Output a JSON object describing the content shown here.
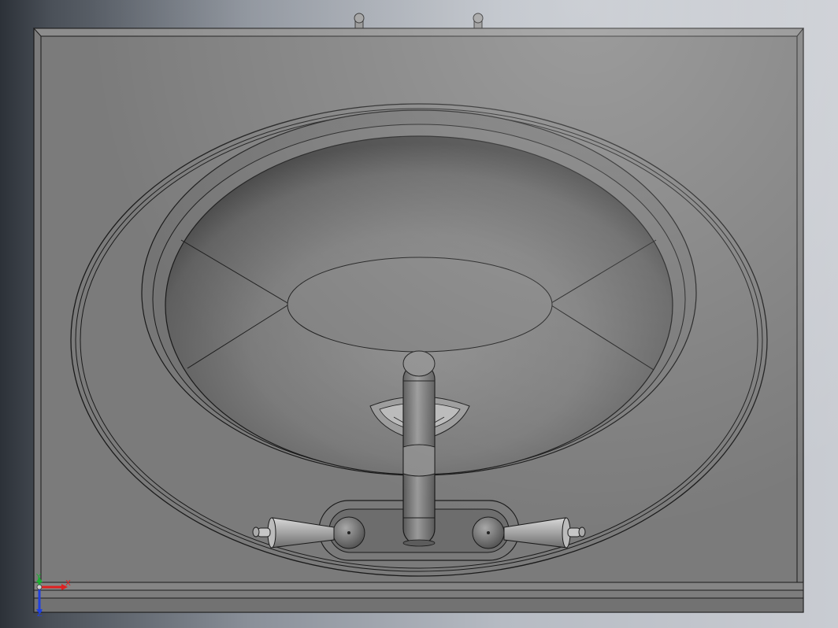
{
  "viewport": {
    "triad": {
      "x_label": "X",
      "y_label": "Y",
      "z_label": "Z",
      "x_color": "#e02020",
      "y_color": "#19b030",
      "z_color": "#2040e0"
    }
  },
  "model": {
    "shade_color": "#7b7b7b",
    "edge_color": "#1a1a1a"
  }
}
